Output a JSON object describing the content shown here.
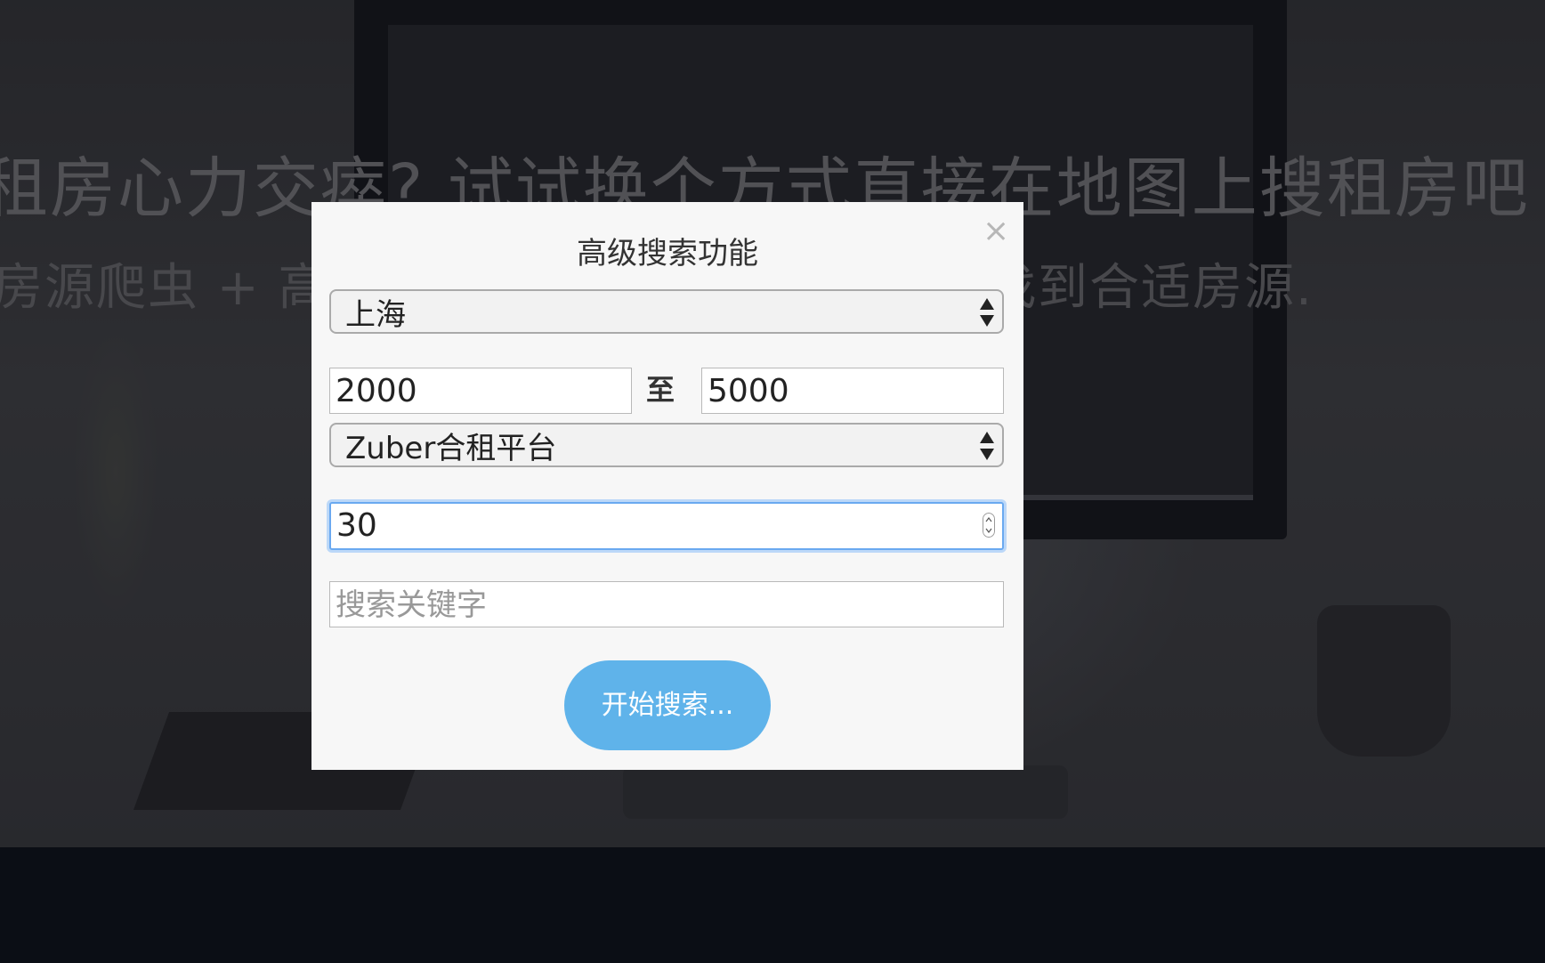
{
  "hero": {
    "title": "租房心力交瘁? 试试换个方式直接在地图上搜租房吧",
    "subtitle_left": "房源爬虫 + 高",
    "subtitle_right": "找到合适房源."
  },
  "modal": {
    "title": "高级搜索功能",
    "close_glyph": "×",
    "city_select": {
      "selected": "上海"
    },
    "price_range": {
      "min": "2000",
      "separator": "至",
      "max": "5000"
    },
    "source_select": {
      "selected": "Zuber合租平台"
    },
    "count_input": {
      "value": "30"
    },
    "keyword_input": {
      "placeholder": "搜索关键字"
    },
    "submit_label": "开始搜索..."
  },
  "colors": {
    "button": "#5fb3ea",
    "focus_ring": "#6aa9f0",
    "modal_bg": "#f7f7f7"
  }
}
